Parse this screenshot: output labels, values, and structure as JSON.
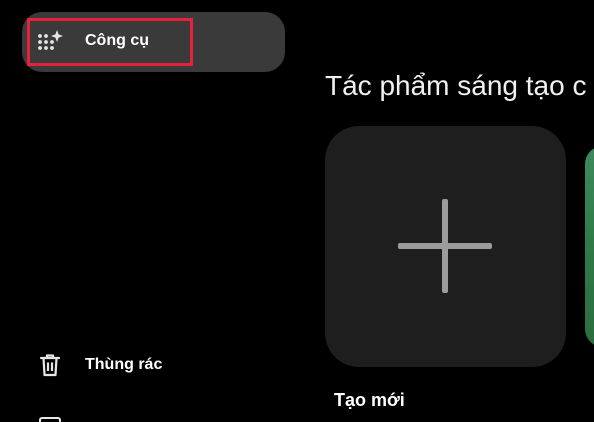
{
  "sidebar": {
    "items": [
      {
        "label": "Công cụ",
        "icon": "sparkle-grid-icon",
        "active": true
      },
      {
        "label": "Thùng rác",
        "icon": "trash-icon"
      }
    ]
  },
  "main": {
    "section_title": "Tác phẩm sáng tạo c",
    "create_card": {
      "label": "Tạo mới",
      "icon": "plus-icon"
    }
  },
  "colors": {
    "background": "#000000",
    "active_item_bg": "#3a3a3a",
    "highlight_border": "#e8203c",
    "card_bg": "#1e1e1e",
    "plus_color": "#9c9c9c",
    "next_card_green": "#2f7a48"
  }
}
